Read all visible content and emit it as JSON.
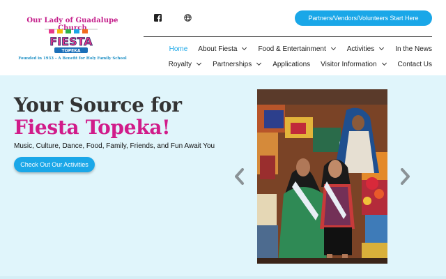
{
  "logo": {
    "church_name": "Our Lady of Guadalupe Church",
    "fiesta_text": "FIESTA",
    "city_text": "TOPEKA",
    "tagline": "Founded in 1933 – A Benefit for Holy Family School"
  },
  "header": {
    "icons": {
      "social": "facebook-icon",
      "language": "globe-icon"
    },
    "cta_label": "Partners/Vendors/Volunteers Start Here"
  },
  "nav": {
    "row1": [
      {
        "label": "Home",
        "dropdown": false,
        "active": true
      },
      {
        "label": "About Fiesta",
        "dropdown": true,
        "active": false
      },
      {
        "label": "Food & Entertainment",
        "dropdown": true,
        "active": false
      },
      {
        "label": "Activities",
        "dropdown": true,
        "active": false
      },
      {
        "label": "In the News",
        "dropdown": false,
        "active": false
      }
    ],
    "row2": [
      {
        "label": "Royalty",
        "dropdown": true,
        "active": false
      },
      {
        "label": "Partnerships",
        "dropdown": true,
        "active": false
      },
      {
        "label": "Applications",
        "dropdown": false,
        "active": false
      },
      {
        "label": "Visitor Information",
        "dropdown": true,
        "active": false
      },
      {
        "label": "Contact Us",
        "dropdown": false,
        "active": false
      }
    ]
  },
  "hero": {
    "title_line1": "Your Source for",
    "title_line2": "Fiesta Topeka!",
    "subtitle": "Music, Culture, Dance, Food, Family, Friends, and Fun Await You",
    "button_label": "Check Out Our Activities",
    "carousel_icons": {
      "prev": "chevron-left-icon",
      "next": "chevron-right-icon"
    }
  },
  "colors": {
    "accent_blue": "#1aa7e8",
    "accent_magenta": "#d11c8a",
    "hero_bg": "#e0f5fb"
  }
}
